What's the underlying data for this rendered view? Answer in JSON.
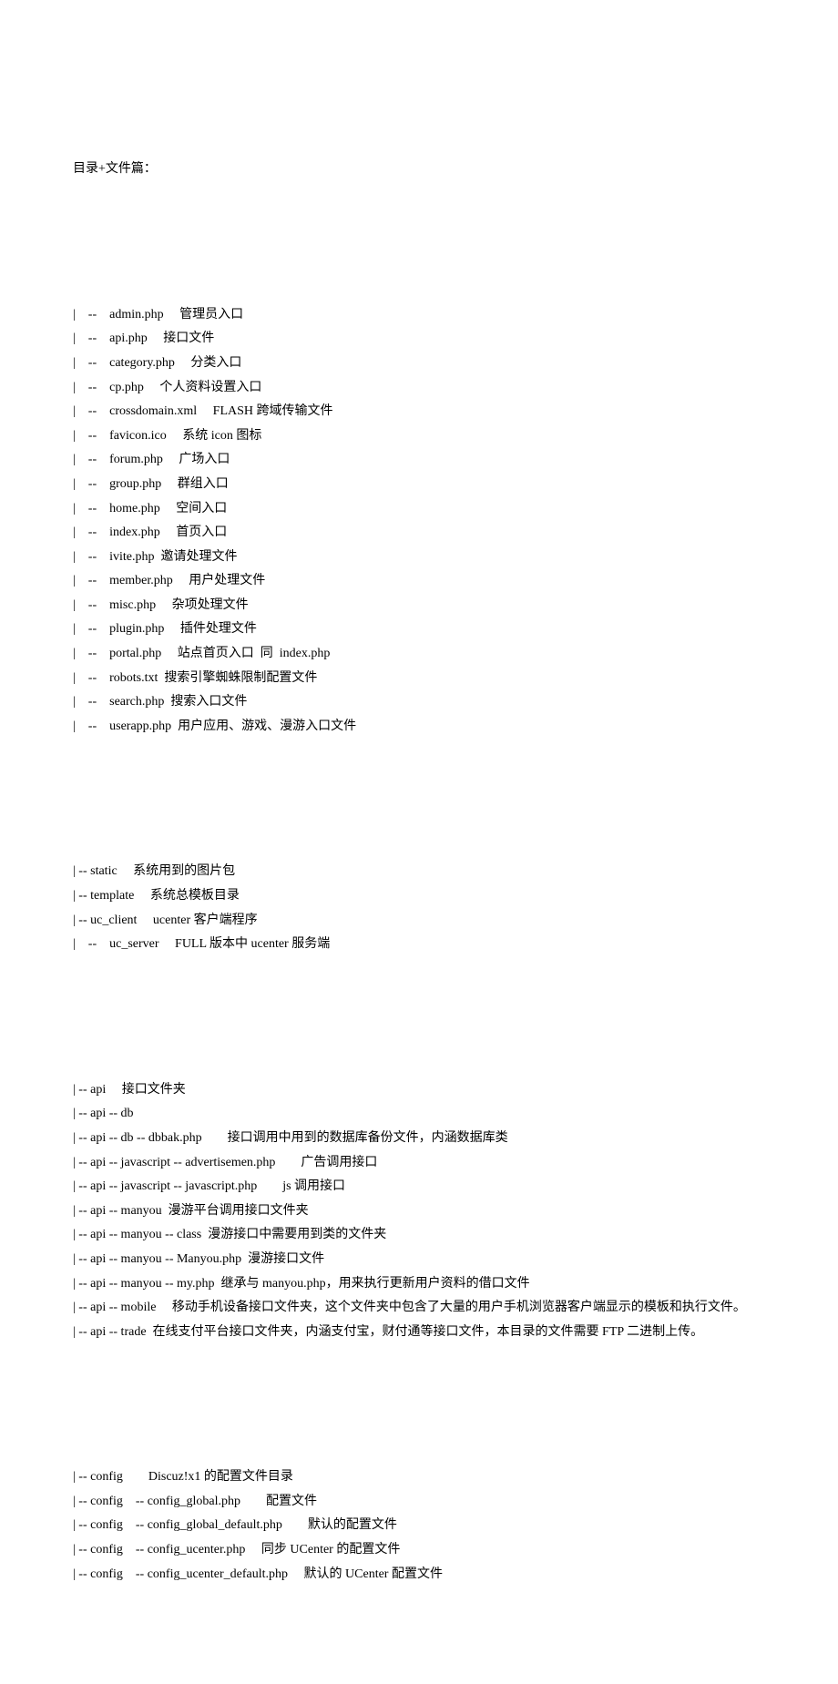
{
  "title": "目录+文件篇：",
  "section1": [
    "|　--　admin.php　 管理员入口",
    "|　--　api.php　 接口文件",
    "|　--　category.php　 分类入口",
    "|　--　cp.php　 个人资料设置入口",
    "|　--　crossdomain.xml　 FLASH 跨域传输文件",
    "|　--　favicon.ico　 系统 icon 图标",
    "|　--　forum.php　 广场入口",
    "|　--　group.php　 群组入口",
    "|　--　home.php　 空间入口",
    "|　--　index.php　 首页入口",
    "|　--　ivite.php  邀请处理文件",
    "|　--　member.php　 用户处理文件",
    "|　--　misc.php　 杂项处理文件",
    "|　--　plugin.php　 插件处理文件",
    "|　--　portal.php　 站点首页入口  同  index.php",
    "|　--　robots.txt  搜索引擎蜘蛛限制配置文件",
    "|　--　search.php  搜索入口文件",
    "|　--　userapp.php  用户应用、游戏、漫游入口文件"
  ],
  "section2": [
    "| -- static　 系统用到的图片包",
    "| -- template　 系统总模板目录",
    "| -- uc_client　 ucenter 客户端程序",
    "|　--　uc_server　 FULL 版本中 ucenter 服务端"
  ],
  "section3": [
    "| -- api　 接口文件夹",
    "| -- api -- db",
    "| -- api -- db -- dbbak.php　　接口调用中用到的数据库备份文件，内涵数据库类",
    "| -- api -- javascript -- advertisemen.php　　广告调用接口",
    "| -- api -- javascript -- javascript.php　　js 调用接口",
    "| -- api -- manyou  漫游平台调用接口文件夹",
    "| -- api -- manyou -- class  漫游接口中需要用到类的文件夹",
    "| -- api -- manyou -- Manyou.php  漫游接口文件",
    "| -- api -- manyou -- my.php  继承与 manyou.php，用来执行更新用户资料的借口文件",
    "| -- api -- mobile　 移动手机设备接口文件夹，这个文件夹中包含了大量的用户手机浏览器客户端显示的模板和执行文件。",
    "| -- api -- trade  在线支付平台接口文件夹，内涵支付宝，财付通等接口文件，本目录的文件需要 FTP 二进制上传。"
  ],
  "section4": [
    "| -- config　　Discuz!x1 的配置文件目录",
    "| -- config　-- config_global.php　　配置文件",
    "| -- config　-- config_global_default.php　　默认的配置文件",
    "| -- config　-- config_ucenter.php　 同步 UCenter 的配置文件",
    "| -- config　-- config_ucenter_default.php　 默认的 UCenter 配置文件"
  ]
}
